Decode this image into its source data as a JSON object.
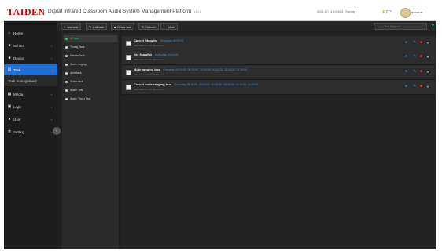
{
  "header": {
    "logo": "TAIDEN",
    "title": "Digital Infrared Classroom Audio System Management Platform",
    "version": "v1.1.0",
    "datetime": "2021-07-14 10:44:37 Sunday",
    "weather": "27°",
    "user": "admin"
  },
  "sidebar": {
    "items": [
      {
        "label": "Home",
        "icon": "home-icon"
      },
      {
        "label": "School",
        "icon": "school-icon"
      },
      {
        "label": "Device",
        "icon": "device-icon"
      },
      {
        "label": "Task",
        "icon": "task-icon"
      },
      {
        "label": "Task management",
        "icon": ""
      },
      {
        "label": "Media",
        "icon": "media-icon"
      },
      {
        "label": "Logs",
        "icon": "logs-icon"
      },
      {
        "label": "User",
        "icon": "user-icon"
      },
      {
        "label": "Setting",
        "icon": "setting-icon"
      }
    ]
  },
  "toolbar": {
    "add": "Add task",
    "edit": "Edit task",
    "delete": "Delete task",
    "refresh": "Refresh",
    "more": "More",
    "search_placeholder": "Task Keyword"
  },
  "groups": [
    "All task",
    "Timing Task",
    "Interim Task",
    "Alarm ringing",
    "Alert task",
    "Alarm task",
    "Alarm Test",
    "Alarm Timer Test"
  ],
  "tasks": [
    {
      "name": "Cancel Standby",
      "schedule": "Everyday 08:00:00",
      "info": "Alert:uses for: All classrooms"
    },
    {
      "name": "Set Standby",
      "schedule": "Everyday 19:00:00",
      "info": "Alert:uses for: All classrooms"
    },
    {
      "name": "Mute ranging bus",
      "schedule": "Everyday 09:15:00, 09:25:00, 10:10:00, 10:20:00, 11:05:00, 11:15:00",
      "info": "Alert:uses for: All classrooms"
    },
    {
      "name": "Cancel mute ranging bus",
      "schedule": "Everyday 08:10:00, 09:20:00, 10:15:00, 10:25:00, 11:10:00, 11:20:00",
      "info": "Alert:uses for: All classrooms"
    }
  ],
  "colors": {
    "accent": "#1f6fd6",
    "green": "#2ecc71",
    "danger": "#e53935",
    "logo": "#d40000"
  }
}
